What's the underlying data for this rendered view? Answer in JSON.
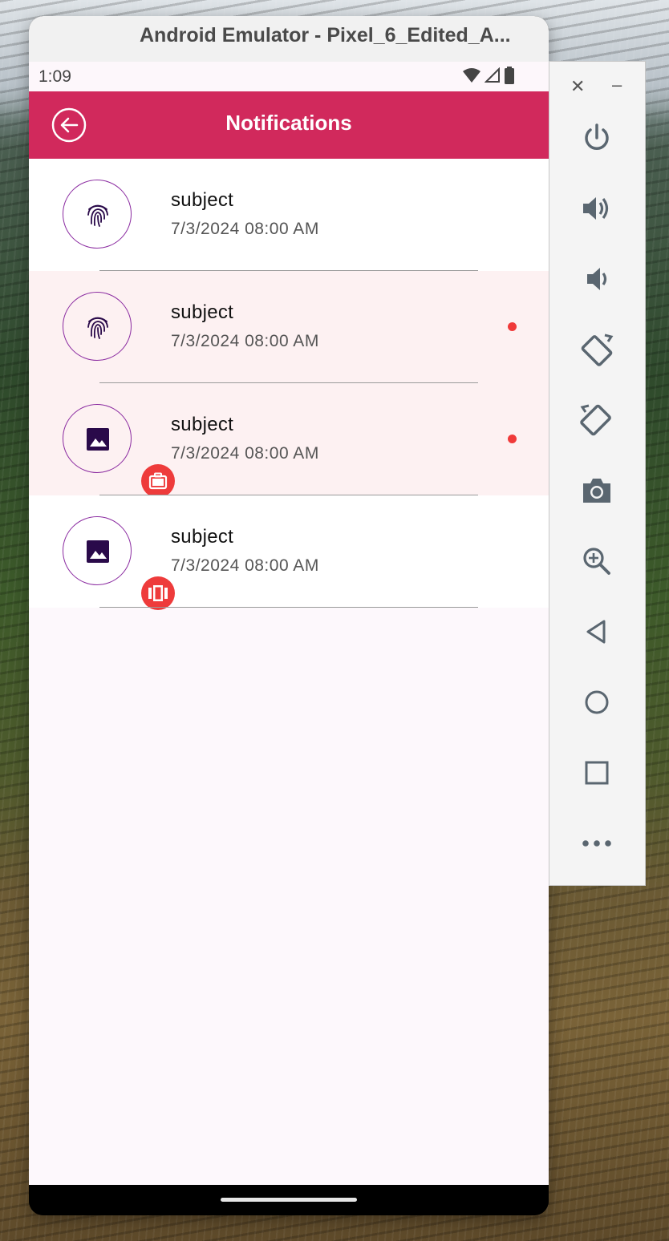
{
  "window": {
    "title": "Android Emulator - Pixel_6_Edited_A..."
  },
  "status_bar": {
    "time": "1:09"
  },
  "app_bar": {
    "title": "Notifications"
  },
  "notifications": [
    {
      "subject": "subject",
      "date": "7/3/2024 08:00 AM",
      "unread": false,
      "icon": "fingerprint-icon",
      "badge": null
    },
    {
      "subject": "subject",
      "date": "7/3/2024 08:00 AM",
      "unread": true,
      "icon": "fingerprint-icon",
      "badge": null
    },
    {
      "subject": "subject",
      "date": "7/3/2024 08:00 AM",
      "unread": true,
      "icon": "image-icon",
      "badge": "briefcase-icon"
    },
    {
      "subject": "subject",
      "date": "7/3/2024 08:00 AM",
      "unread": false,
      "icon": "image-icon",
      "badge": "view-carousel-icon"
    }
  ],
  "side_panel": {
    "buttons": [
      "power-icon",
      "volume-up-icon",
      "volume-down-icon",
      "rotate-left-icon",
      "rotate-right-icon",
      "camera-icon",
      "zoom-icon",
      "back-icon",
      "home-icon",
      "overview-icon",
      "more-icon"
    ]
  },
  "colors": {
    "app_bar": "#d1295c",
    "unread_row": "#fdf1f2",
    "unread_dot": "#f03a3a",
    "badge": "#ee3b3b",
    "avatar_border": "#8a2aa0",
    "icon_dark": "#2a0a4a"
  }
}
